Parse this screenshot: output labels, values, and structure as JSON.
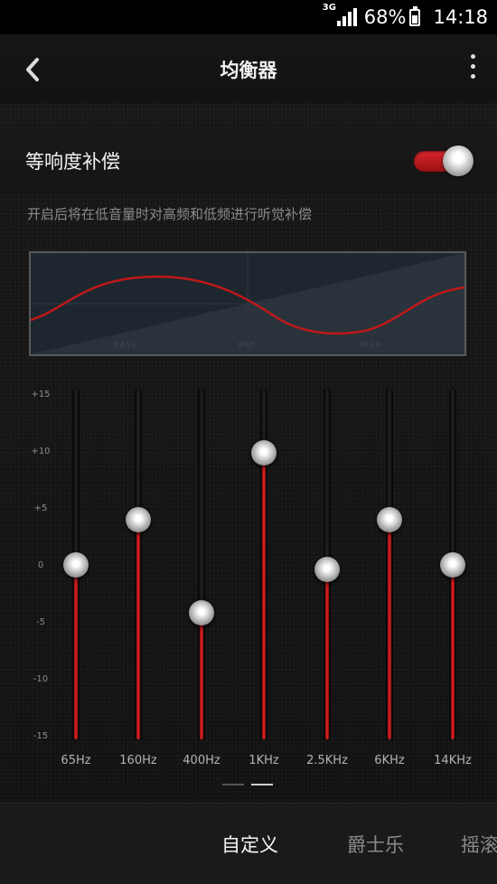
{
  "status": {
    "network": "3G",
    "battery": "68%",
    "time": "14:18"
  },
  "header": {
    "title": "均衡器"
  },
  "loudness": {
    "label": "等响度补偿",
    "enabled": true,
    "description": "开启后将在低音量时对高频和低频进行听觉补偿"
  },
  "curve": {
    "bands": [
      "BASS",
      "MID",
      "HIGH"
    ]
  },
  "equalizer": {
    "db_labels": [
      "+15",
      "+10",
      "+5",
      "0",
      "-5",
      "-10",
      "-15"
    ],
    "range": [
      -15,
      15
    ],
    "bands": [
      {
        "label": "65Hz",
        "value": 0
      },
      {
        "label": "160Hz",
        "value": 4.2
      },
      {
        "label": "400Hz",
        "value": -4.5
      },
      {
        "label": "1KHz",
        "value": 10.5
      },
      {
        "label": "2.5KHz",
        "value": -0.4
      },
      {
        "label": "6KHz",
        "value": 4.2
      },
      {
        "label": "14KHz",
        "value": 0
      }
    ]
  },
  "presets": {
    "items": [
      "自定义",
      "爵士乐",
      "摇滚"
    ],
    "active": 0
  },
  "colors": {
    "accent": "#e32525",
    "background": "#161616"
  }
}
